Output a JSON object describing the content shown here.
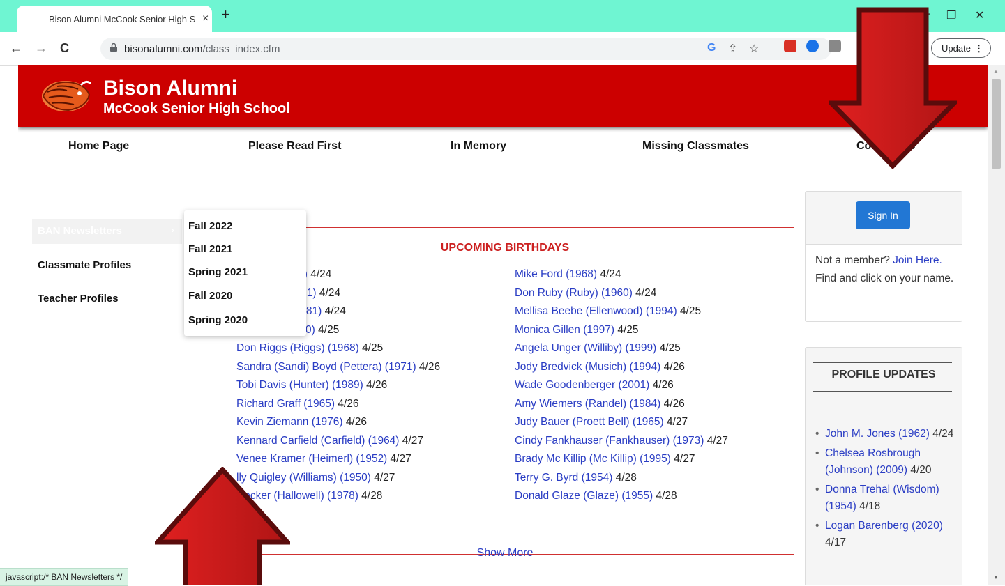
{
  "browser": {
    "tab_title": "Bison Alumni McCook Senior High School",
    "tab_close": "×",
    "new_tab": "+",
    "url_host": "bisonalumni.com",
    "url_path": "/class_index.cfm",
    "update_label": "Update",
    "update_menu": "⋮",
    "status_text": "javascript:/* BAN Newsletters */",
    "icons": {
      "back": "←",
      "forward": "→",
      "reload": "C",
      "google": "G",
      "share": "⇪",
      "bookmark": "☆",
      "minimize": "─",
      "restore": "❐",
      "close": "✕"
    }
  },
  "site": {
    "title": "Bison Alumni",
    "subtitle": "McCook Senior High School"
  },
  "main_nav": [
    {
      "label": "Home Page"
    },
    {
      "label": "Please Read First"
    },
    {
      "label": "In Memory"
    },
    {
      "label": "Missing Classmates"
    },
    {
      "label": "Contact Us"
    }
  ],
  "side_nav": {
    "newsletters_label": "BAN Newsletters",
    "classmate_profiles": "Classmate Profiles",
    "teacher_profiles": "Teacher Profiles"
  },
  "newsletter_menu": [
    "Fall 2022",
    "Fall 2021",
    "Spring 2021",
    "Fall 2020",
    "Spring 2020"
  ],
  "birthdays": {
    "title": "UPCOMING BIRTHDAYS",
    "left": [
      {
        "name": "Walker) (1983)",
        "date": "4/24"
      },
      {
        "name": "l (Lesher) (1991)",
        "date": "4/24"
      },
      {
        "name": "ider (Roth) (1981)",
        "date": "4/24"
      },
      {
        "name": "(Mintling) (1990)",
        "date": "4/25"
      },
      {
        "name": "Don Riggs (Riggs) (1968)",
        "date": "4/25"
      },
      {
        "name": "Sandra (Sandi) Boyd (Pettera) (1971)",
        "date": "4/26"
      },
      {
        "name": "Tobi Davis (Hunter) (1989)",
        "date": "4/26"
      },
      {
        "name": "Richard Graff (1965)",
        "date": "4/26"
      },
      {
        "name": "Kevin Ziemann (1976)",
        "date": "4/26"
      },
      {
        "name": "Kennard Carfield (Carfield) (1964)",
        "date": "4/27"
      },
      {
        "name": "Venee Kramer (Heimerl) (1952)",
        "date": "4/27"
      },
      {
        "name": "lly Quigley (Williams) (1950)",
        "date": "4/27"
      },
      {
        "name": "Decker (Hallowell) (1978)",
        "date": "4/28"
      }
    ],
    "right": [
      {
        "name": "Mike Ford (1968)",
        "date": "4/24"
      },
      {
        "name": "Don Ruby (Ruby) (1960)",
        "date": "4/24"
      },
      {
        "name": "Mellisa Beebe (Ellenwood) (1994)",
        "date": "4/25"
      },
      {
        "name": "Monica Gillen (1997)",
        "date": "4/25"
      },
      {
        "name": "Angela Unger (Williby) (1999)",
        "date": "4/25"
      },
      {
        "name": "Jody Bredvick (Musich) (1994)",
        "date": "4/26"
      },
      {
        "name": "Wade Goodenberger (2001)",
        "date": "4/26"
      },
      {
        "name": "Amy Wiemers (Randel) (1984)",
        "date": "4/26"
      },
      {
        "name": "Judy Bauer (Proett Bell) (1965)",
        "date": "4/27"
      },
      {
        "name": "Cindy Fankhauser (Fankhauser) (1973)",
        "date": "4/27"
      },
      {
        "name": "Brady Mc Killip (Mc Killip) (1995)",
        "date": "4/27"
      },
      {
        "name": "Terry G. Byrd (1954)",
        "date": "4/28"
      },
      {
        "name": "Donald Glaze (Glaze) (1955)",
        "date": "4/28"
      }
    ],
    "show_more": "Show More"
  },
  "signin": {
    "button": "Sign In",
    "text_before": "Not a member?",
    "join_link": "Join Here.",
    "text_after": "Find and click on your name."
  },
  "profile_updates": {
    "title": "PROFILE UPDATES",
    "items": [
      {
        "name": "John M. Jones (1962)",
        "date": "4/24"
      },
      {
        "name": "Chelsea Rosbrough (Johnson) (2009)",
        "date": "4/20"
      },
      {
        "name": "Donna Trehal (Wisdom) (1954)",
        "date": "4/18"
      },
      {
        "name": "Logan Barenberg (2020)",
        "date": "4/17"
      }
    ]
  },
  "colors": {
    "banner": "#cc0000",
    "link": "#2a3dc4",
    "tabbar": "#6ff5d2",
    "arrow": "#a01818",
    "signin": "#2277d4"
  }
}
